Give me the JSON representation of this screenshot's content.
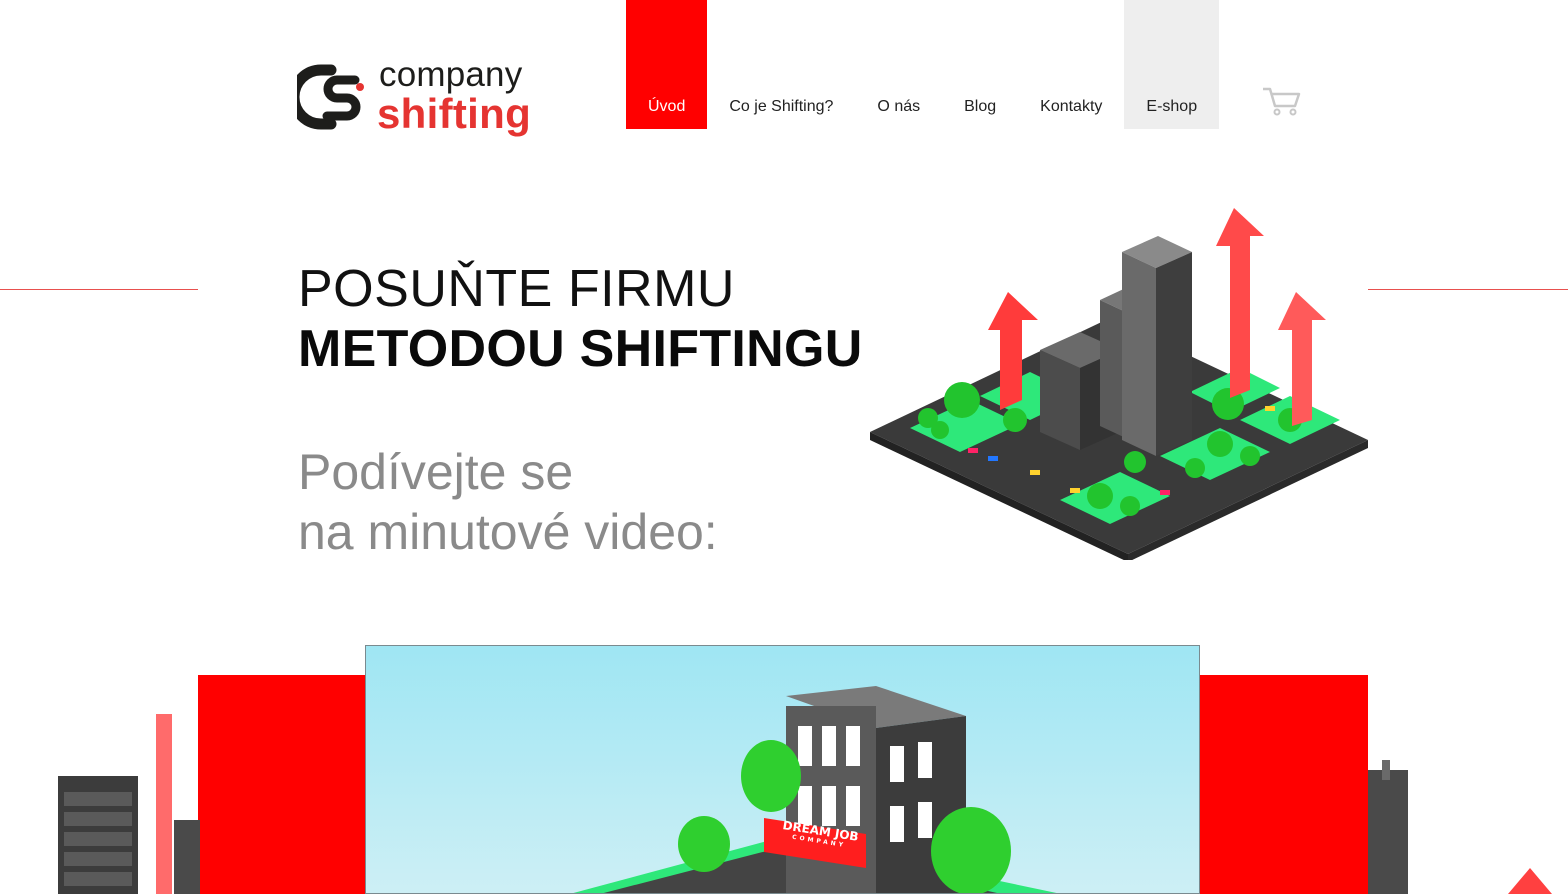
{
  "logo": {
    "line1": "company",
    "line2": "shifting"
  },
  "nav": {
    "items": [
      {
        "label": "Úvod",
        "state": "active"
      },
      {
        "label": "Co je Shifting?"
      },
      {
        "label": "O nás"
      },
      {
        "label": "Blog"
      },
      {
        "label": "Kontakty"
      },
      {
        "label": "E-shop",
        "state": "highlighted"
      }
    ],
    "cart_icon": "shopping-cart-icon"
  },
  "hero": {
    "title_line1": "POSUŇTE FIRMU",
    "title_line2": "METODOU SHIFTINGU",
    "sub_line1": "Podívejte se",
    "sub_line2": "na minutové video:"
  },
  "video": {
    "sign_line1": "DREAM JOB",
    "sign_line2": "COMPANY"
  },
  "colors": {
    "accent": "#ff0000",
    "logo_red": "#e53431",
    "text_dark": "#111111",
    "subtitle_gray": "#8a8a8a"
  }
}
